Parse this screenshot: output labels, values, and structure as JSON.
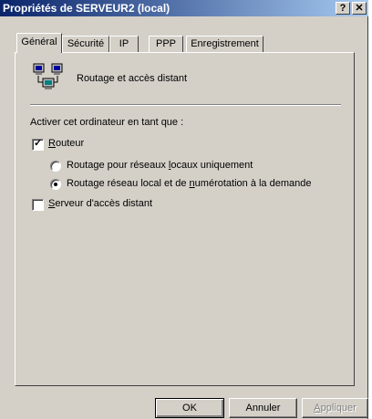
{
  "window": {
    "title": "Propriétés de SERVEUR2 (local)",
    "help_glyph": "?",
    "close_glyph": "✕"
  },
  "tabs": [
    {
      "label": "Général",
      "active": true
    },
    {
      "label": "Sécurité",
      "active": false
    },
    {
      "label": "IP",
      "active": false
    },
    {
      "label": "PPP",
      "active": false
    },
    {
      "label": "Enregistrement",
      "active": false
    }
  ],
  "panel": {
    "icon": "network-computers-icon",
    "service_label": "Routage et accès distant",
    "section_label": "Activer cet ordinateur en tant que :",
    "router": {
      "before": "",
      "underlined": "R",
      "after": "outeur",
      "checked": true
    },
    "radio_lan": {
      "before": "Routage pour réseaux ",
      "underlined": "l",
      "after": "ocaux uniquement",
      "selected": false
    },
    "radio_demand": {
      "before": "Routage réseau local et de ",
      "underlined": "n",
      "after": "umérotation à la demande",
      "selected": true
    },
    "remote_server": {
      "before": "",
      "underlined": "S",
      "after": "erveur d'accès distant",
      "checked": false
    },
    "check_glyph": "✓"
  },
  "buttons": {
    "ok": "OK",
    "cancel": "Annuler",
    "apply_underlined": "A",
    "apply_rest": "ppliquer",
    "apply_enabled": false
  },
  "colors": {
    "face": "#d4d0c8",
    "title_start": "#0a246a",
    "title_end": "#a6caf0"
  }
}
